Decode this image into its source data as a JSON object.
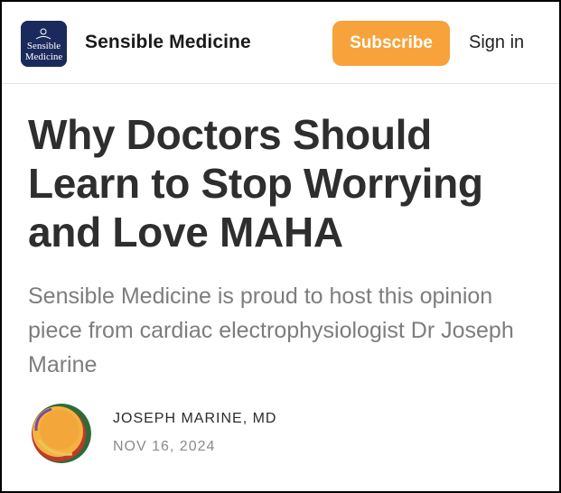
{
  "header": {
    "publication_name": "Sensible Medicine",
    "logo_text_line1": "Sensible",
    "logo_text_line2": "Medicine",
    "subscribe_label": "Subscribe",
    "signin_label": "Sign in"
  },
  "article": {
    "title": "Why Doctors Should Learn to Stop Worrying and Love MAHA",
    "subtitle": "Sensible Medicine is proud to host this opinion piece from cardiac electrophysiologist Dr Joseph Marine",
    "author": "JOSEPH MARINE, MD",
    "date": "NOV 16, 2024"
  },
  "colors": {
    "accent": "#f7a23b",
    "logo_background": "#1b2a5c",
    "title": "#2e2e2e",
    "subtitle": "#7d7d7d"
  },
  "icons": {
    "logo": "sensible-medicine-logo",
    "avatar": "author-avatar"
  }
}
